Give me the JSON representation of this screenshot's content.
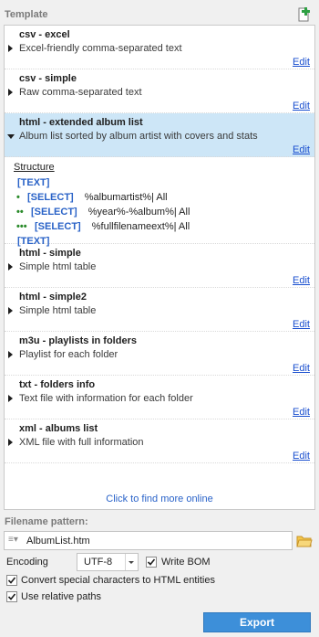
{
  "template_section": {
    "title": "Template"
  },
  "templates": [
    {
      "title": "csv - excel",
      "desc": "Excel-friendly comma-separated text",
      "edit": "Edit",
      "expanded": false
    },
    {
      "title": "csv - simple",
      "desc": "Raw comma-separated text",
      "edit": "Edit",
      "expanded": false
    },
    {
      "title": "html - extended album list",
      "desc": "Album list sorted by album artist with covers and stats",
      "edit": "Edit",
      "expanded": true
    },
    {
      "title": "html - simple",
      "desc": "Simple html table",
      "edit": "Edit",
      "expanded": false
    },
    {
      "title": "html - simple2",
      "desc": "Simple html table",
      "edit": "Edit",
      "expanded": false
    },
    {
      "title": "m3u - playlists in folders",
      "desc": "Playlist for each folder",
      "edit": "Edit",
      "expanded": false
    },
    {
      "title": "txt - folders info",
      "desc": "Text file with information for each folder",
      "edit": "Edit",
      "expanded": false
    },
    {
      "title": "xml - albums list",
      "desc": "XML file with full information",
      "edit": "Edit",
      "expanded": false
    }
  ],
  "structure": {
    "heading": "Structure",
    "lines": [
      {
        "dots": "",
        "tag": "[TEXT]",
        "text": ""
      },
      {
        "dots": "•",
        "tag": "[SELECT]",
        "text": "%albumartist%| All"
      },
      {
        "dots": "••",
        "tag": "[SELECT]",
        "text": "%year%-%album%| All"
      },
      {
        "dots": "•••",
        "tag": "[SELECT]",
        "text": "%fullfilenameext%| All"
      },
      {
        "dots": "",
        "tag": "[TEXT]",
        "text": ""
      }
    ]
  },
  "find_more": "Click to find more online",
  "filename": {
    "label": "Filename pattern:",
    "value": "AlbumList.htm"
  },
  "encoding": {
    "label": "Encoding",
    "value": "UTF-8"
  },
  "options": {
    "write_bom": {
      "label": "Write BOM",
      "checked": true
    },
    "convert_special": {
      "label": "Convert special characters to HTML entities",
      "checked": true
    },
    "relative_paths": {
      "label": "Use relative paths",
      "checked": true
    }
  },
  "export_label": "Export",
  "colors": {
    "selected_bg": "#cde6f7",
    "link": "#1a4fcf",
    "export_bg": "#3d8fd9",
    "tag": "#2962c7",
    "dots": "#2a8a2a"
  }
}
